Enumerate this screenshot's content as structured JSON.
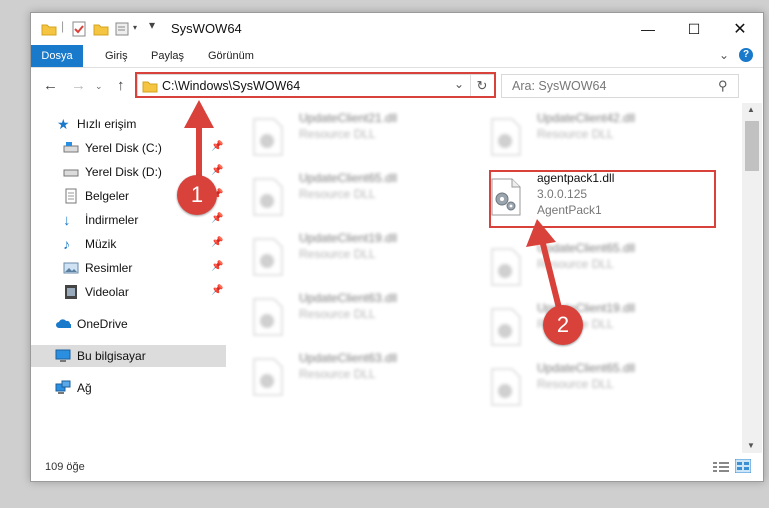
{
  "window": {
    "title": "SysWOW64"
  },
  "ribbon": {
    "tabs": [
      "Dosya",
      "Giriş",
      "Paylaş",
      "Görünüm"
    ]
  },
  "address": {
    "path": "C:\\Windows\\SysWOW64"
  },
  "search": {
    "placeholder": "Ara: SysWOW64"
  },
  "sidebar": {
    "items": [
      {
        "label": "Hızlı erişim"
      },
      {
        "label": "Yerel Disk (C:)"
      },
      {
        "label": "Yerel Disk (D:)"
      },
      {
        "label": "Belgeler"
      },
      {
        "label": "İndirmeler"
      },
      {
        "label": "Müzik"
      },
      {
        "label": "Resimler"
      },
      {
        "label": "Videolar"
      },
      {
        "label": "OneDrive"
      },
      {
        "label": "Bu bilgisayar"
      },
      {
        "label": "Ağ"
      }
    ]
  },
  "files": {
    "highlighted": {
      "name": "agentpack1.dll",
      "version": "3.0.0.125",
      "description": "AgentPack1"
    },
    "left_column": [
      {
        "name": "UpdateClient21.dll",
        "desc": "Resource DLL"
      },
      {
        "name": "UpdateClient65.dll",
        "desc": "Resource DLL"
      },
      {
        "name": "UpdateClient19.dll",
        "desc": "Resource DLL"
      },
      {
        "name": "UpdateClient63.dll",
        "desc": "Resource DLL"
      },
      {
        "name": "UpdateClient63.dll",
        "desc": "Resource DLL"
      }
    ],
    "right_column": [
      {
        "name": "UpdateClient42.dll",
        "desc": "Resource DLL"
      },
      {
        "name": "UpdateClient65.dll",
        "desc": "Resource DLL"
      },
      {
        "name": "UpdateClient19.dll",
        "desc": "Resource DLL"
      },
      {
        "name": "UpdateClient65.dll",
        "desc": "Resource DLL"
      }
    ]
  },
  "status": {
    "item_count": "109 öğe"
  },
  "annotations": {
    "badge1": "1",
    "badge2": "2"
  },
  "colors": {
    "accent": "#1979ca",
    "annotation": "#d9413b"
  }
}
